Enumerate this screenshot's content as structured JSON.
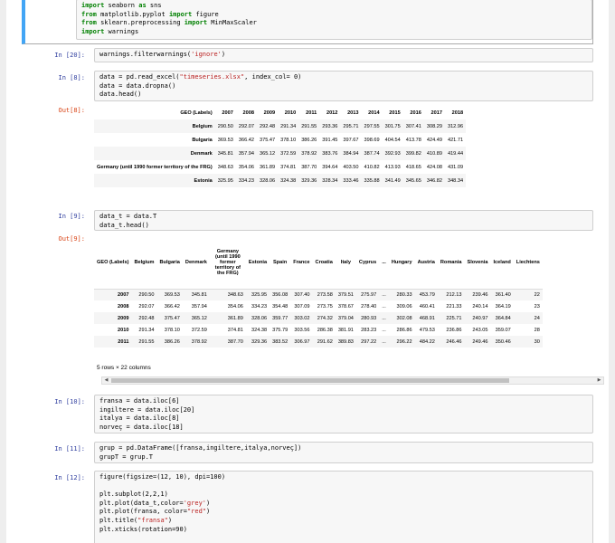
{
  "cells": {
    "c0": {
      "lines": [
        "import seaborn as sns",
        "from matplotlib.pyplot import figure",
        "from sklearn.preprocessing import MinMaxScaler",
        "import warnings"
      ]
    },
    "c20": {
      "prompt": "In [20]:",
      "lines": [
        "warnings.filterwarnings('ignore')"
      ]
    },
    "c8": {
      "prompt": "In [8]:",
      "lines": [
        "data = pd.read_excel(\"timeseries.xlsx\", index_col= 0)",
        "data = data.dropna()",
        "data.head()"
      ],
      "out_prompt": "Out[8]:"
    },
    "c9": {
      "prompt": "In [9]:",
      "lines": [
        "data_t = data.T",
        "data_t.head()"
      ],
      "out_prompt": "Out[9]:"
    },
    "c10": {
      "prompt": "In [10]:",
      "lines": [
        "fransa = data.iloc[6]",
        "ingiltere = data.iloc[20]",
        "italya = data.iloc[8]",
        "norveç = data.iloc[18]"
      ]
    },
    "c11": {
      "prompt": "In [11]:",
      "lines": [
        "grup = pd.DataFrame([fransa,ingiltere,italya,norveç])",
        "grupT = grup.T"
      ]
    },
    "c12": {
      "prompt": "In [12]:",
      "lines": [
        "figure(figsize=(12, 10), dpi=100)",
        "",
        "plt.subplot(2,2,1)",
        "plt.plot(data_t,color='grey')",
        "plt.plot(fransa, color=\"red\")",
        "plt.title(\"fransa\")",
        "plt.xticks(rotation=90)"
      ]
    }
  },
  "df1": {
    "index_name": "GEO (Labels)",
    "columns": [
      "2007",
      "2008",
      "2009",
      "2010",
      "2011",
      "2012",
      "2013",
      "2014",
      "2015",
      "2016",
      "2017",
      "2018"
    ],
    "rows": [
      {
        "label": "Belgium",
        "values": [
          "290.50",
          "292.07",
          "292.48",
          "291.34",
          "291.55",
          "293.36",
          "295.71",
          "297.55",
          "301.75",
          "307.41",
          "308.29",
          "312.96"
        ]
      },
      {
        "label": "Bulgaria",
        "values": [
          "369.53",
          "366.42",
          "375.47",
          "378.10",
          "386.26",
          "391.45",
          "397.67",
          "398.69",
          "404.54",
          "413.78",
          "424.49",
          "421.71"
        ]
      },
      {
        "label": "Denmark",
        "values": [
          "345.81",
          "357.94",
          "365.12",
          "372.59",
          "378.92",
          "383.76",
          "384.94",
          "387.74",
          "392.93",
          "399.82",
          "410.89",
          "419.44"
        ]
      },
      {
        "label": "Germany (until 1990 former territory of the FRG)",
        "values": [
          "348.63",
          "354.06",
          "361.89",
          "374.81",
          "387.70",
          "394.64",
          "403.50",
          "410.82",
          "413.93",
          "418.65",
          "424.08",
          "431.09"
        ]
      },
      {
        "label": "Estonia",
        "values": [
          "325.95",
          "334.23",
          "328.06",
          "324.38",
          "329.36",
          "328.34",
          "333.46",
          "335.88",
          "341.49",
          "345.65",
          "346.82",
          "348.34"
        ]
      }
    ]
  },
  "df2": {
    "index_name": "GEO (Labels)",
    "columns": [
      "Belgium",
      "Bulgaria",
      "Denmark",
      "Germany (until 1990 former territory of the FRG)",
      "Estonia",
      "Spain",
      "France",
      "Croatia",
      "Italy",
      "Cyprus",
      "...",
      "Hungary",
      "Austria",
      "Romania",
      "Slovenia",
      "Iceland",
      "Liechtens"
    ],
    "rows": [
      {
        "label": "2007",
        "values": [
          "290.50",
          "369.53",
          "345.81",
          "348.63",
          "325.95",
          "356.08",
          "307.40",
          "273.58",
          "379.51",
          "275.97",
          "...",
          "280.33",
          "453.79",
          "212.13",
          "239.46",
          "361.40",
          "22"
        ]
      },
      {
        "label": "2008",
        "values": [
          "292.07",
          "366.42",
          "357.94",
          "354.06",
          "334.23",
          "354.48",
          "307.09",
          "273.75",
          "378.67",
          "278.40",
          "...",
          "309.06",
          "460.41",
          "221.33",
          "240.14",
          "364.19",
          "23"
        ]
      },
      {
        "label": "2009",
        "values": [
          "292.48",
          "375.47",
          "365.12",
          "361.89",
          "328.06",
          "359.77",
          "303.02",
          "274.32",
          "379.04",
          "280.93",
          "...",
          "302.08",
          "468.91",
          "225.71",
          "240.97",
          "364.84",
          "24"
        ]
      },
      {
        "label": "2010",
        "values": [
          "291.34",
          "378.10",
          "372.59",
          "374.81",
          "324.38",
          "375.79",
          "303.56",
          "286.38",
          "381.91",
          "283.23",
          "...",
          "286.86",
          "479.53",
          "236.86",
          "243.05",
          "359.07",
          "28"
        ]
      },
      {
        "label": "2011",
        "values": [
          "291.55",
          "386.26",
          "378.92",
          "387.70",
          "329.36",
          "383.52",
          "306.97",
          "291.62",
          "389.83",
          "297.22",
          "...",
          "296.22",
          "484.22",
          "246.46",
          "249.46",
          "350.46",
          "30"
        ]
      }
    ],
    "shape_text": "5 rows × 22 columns"
  }
}
